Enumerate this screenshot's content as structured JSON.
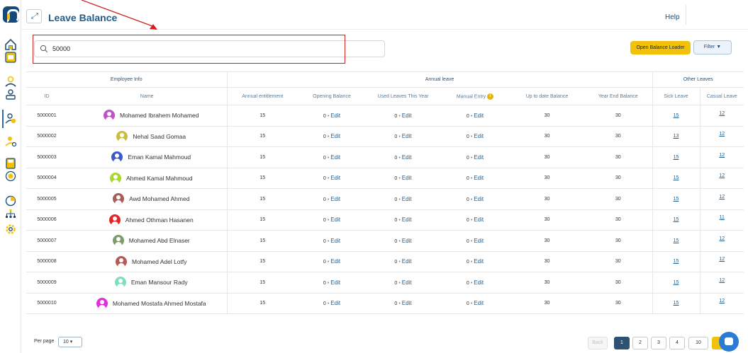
{
  "header": {
    "title": "Leave Balance",
    "help": "Help",
    "expand_icon": "expand-icon"
  },
  "search": {
    "value": "50000",
    "placeholder": "",
    "icon": "search-icon"
  },
  "actions": {
    "loader_label": "Open Balance Loader",
    "filter_label": "Filter ▼"
  },
  "table": {
    "groups": {
      "employee": "Employee Info",
      "annual": "Annual leave",
      "other": "Other Leaves"
    },
    "columns": {
      "id": "ID",
      "name": "Name",
      "entitlement": "Annual entitlement",
      "opening": "Opening Balance",
      "used": "Used Leaves This Year",
      "manual": "Manual Entry",
      "uptodate": "Up to date Balance",
      "yearend": "Year End Balance",
      "sick": "Sick Leave",
      "casual": "Casual Leave"
    },
    "edit_label": "Edit",
    "rows": [
      {
        "id": "5000001",
        "name": "Mohamed Ibrahem Mohamed",
        "avatar_color": "#c251c9",
        "entitlement": "15",
        "opening": "0",
        "used": "0",
        "manual": "0",
        "uptodate": "30",
        "yearend": "30",
        "sick": "15",
        "casual": "12"
      },
      {
        "id": "5000002",
        "name": "Nehal Saad Gomaa",
        "avatar_color": "#c9bf3f",
        "entitlement": "15",
        "opening": "0",
        "used": "0",
        "manual": "0",
        "uptodate": "30",
        "yearend": "30",
        "sick": "13",
        "casual": "12"
      },
      {
        "id": "5000003",
        "name": "Eman Kamal Mahmoud",
        "avatar_color": "#3d59c9",
        "entitlement": "15",
        "opening": "0",
        "used": "0",
        "manual": "0",
        "uptodate": "30",
        "yearend": "30",
        "sick": "15",
        "casual": "12"
      },
      {
        "id": "5000004",
        "name": "Ahmed Kamal Mahmoud",
        "avatar_color": "#a8d92b",
        "entitlement": "15",
        "opening": "0",
        "used": "0",
        "manual": "0",
        "uptodate": "30",
        "yearend": "30",
        "sick": "15",
        "casual": "12"
      },
      {
        "id": "5000005",
        "name": "Awd Mohamed Ahmed",
        "avatar_color": "#a55e58",
        "entitlement": "15",
        "opening": "0",
        "used": "0",
        "manual": "0",
        "uptodate": "30",
        "yearend": "30",
        "sick": "15",
        "casual": "12"
      },
      {
        "id": "5000006",
        "name": "Ahmed Othman Hasanen",
        "avatar_color": "#e42525",
        "entitlement": "15",
        "opening": "0",
        "used": "0",
        "manual": "0",
        "uptodate": "30",
        "yearend": "30",
        "sick": "15",
        "casual": "11"
      },
      {
        "id": "5000007",
        "name": "Mohamed Abd Elnaser",
        "avatar_color": "#7f9a6c",
        "entitlement": "15",
        "opening": "0",
        "used": "0",
        "manual": "0",
        "uptodate": "30",
        "yearend": "30",
        "sick": "15",
        "casual": "12"
      },
      {
        "id": "5000008",
        "name": "Mohamed Adel Lotfy",
        "avatar_color": "#b75a55",
        "entitlement": "15",
        "opening": "0",
        "used": "0",
        "manual": "0",
        "uptodate": "30",
        "yearend": "30",
        "sick": "15",
        "casual": "12"
      },
      {
        "id": "5000009",
        "name": "Eman Mansour Rady",
        "avatar_color": "#7ce0c0",
        "entitlement": "15",
        "opening": "0",
        "used": "0",
        "manual": "0",
        "uptodate": "30",
        "yearend": "30",
        "sick": "15",
        "casual": "12"
      },
      {
        "id": "5000010",
        "name": "Mohamed Mostafa Ahmed Mostafa",
        "avatar_color": "#e32be0",
        "entitlement": "15",
        "opening": "0",
        "used": "0",
        "manual": "0",
        "uptodate": "30",
        "yearend": "30",
        "sick": "15",
        "casual": "12"
      }
    ]
  },
  "pagination": {
    "per_page_label": "Per page",
    "per_page_value": "10 ▾",
    "back_label": "Back",
    "pages": [
      "1",
      "2",
      "3",
      "4",
      "10"
    ],
    "active_page": "1"
  },
  "colors": {
    "brand_blue": "#1f5d8e",
    "accent_yellow": "#f2c10a",
    "highlight_red": "#cf1f1f"
  }
}
